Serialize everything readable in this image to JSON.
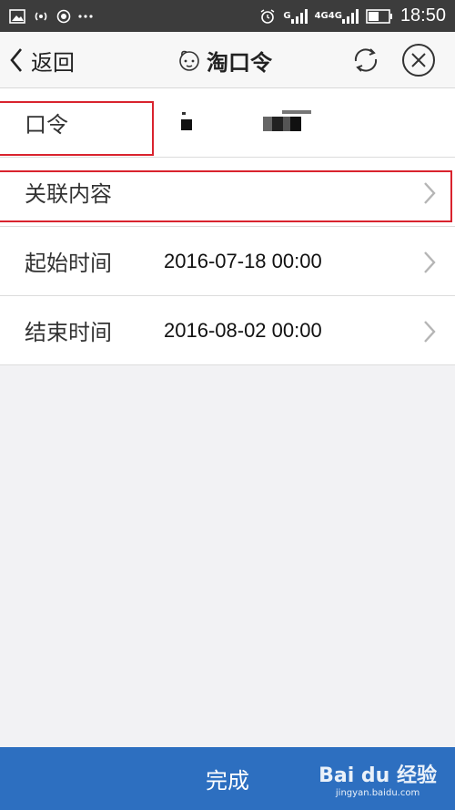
{
  "status_bar": {
    "time": "18:50",
    "network_1": "G",
    "network_2": "4G",
    "network_3": "4G"
  },
  "nav": {
    "back_label": "返回",
    "title": "淘口令"
  },
  "rows": [
    {
      "label": "口令",
      "value": ""
    },
    {
      "label": "关联内容",
      "value": ""
    },
    {
      "label": "起始时间",
      "value": "2016-07-18 00:00"
    },
    {
      "label": "结束时间",
      "value": "2016-08-02 00:00"
    }
  ],
  "done_label": "完成",
  "watermark": {
    "brand": "Bai du 经验",
    "url": "jingyan.baidu.com"
  },
  "colors": {
    "status_bar": "#3c3c3c",
    "nav_bg": "#f7f7f7",
    "accent": "#2d6fc0",
    "highlight": "#d9232e",
    "page_bg": "#f2f2f4"
  }
}
